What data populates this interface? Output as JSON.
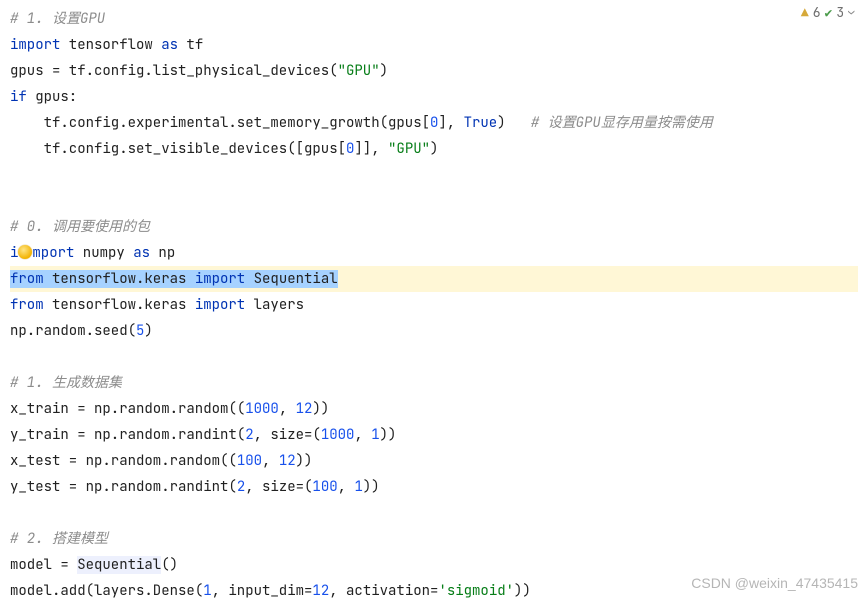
{
  "inspections": {
    "warning_count": "6",
    "ok_count": "3"
  },
  "code": {
    "c1_comment": "# 1. 设置GPU",
    "c1_l1a": "import",
    "c1_l1b": " tensorflow ",
    "c1_l1c": "as",
    "c1_l1d": " tf",
    "c1_l2a": "gpus = tf.config.list_physical_devices(",
    "c1_l2s": "\"GPU\"",
    "c1_l2b": ")",
    "c1_l3a": "if",
    "c1_l3b": " gpus:",
    "c1_l4a": "    tf.config.experimental.set_memory_growth(gpus[",
    "c1_l4n": "0",
    "c1_l4b": "], ",
    "c1_l4t": "True",
    "c1_l4c": ")   ",
    "c1_l4cm": "# 设置GPU显存用量按需使用",
    "c1_l5a": "    tf.config.set_visible_devices([gpus[",
    "c1_l5n": "0",
    "c1_l5b": "]], ",
    "c1_l5s": "\"GPU\"",
    "c1_l5c": ")",
    "c0_comment": "# 0. 调用要使用的包",
    "c0_l1a": "mport",
    "c0_l1b": " numpy ",
    "c0_l1c": "as",
    "c0_l1d": " np",
    "c0_l2a": "from",
    "c0_l2b": " tensorflow.keras ",
    "c0_l2c": "import",
    "c0_l2d": " Sequential",
    "c0_l3a": "from",
    "c0_l3b": " tensorflow.keras ",
    "c0_l3c": "import",
    "c0_l3d": " layers",
    "c0_l4": "np.random.seed(",
    "c0_l4n": "5",
    "c0_l4b": ")",
    "s1_comment": "# 1. 生成数据集",
    "s1_l1a": "x_train = np.random.random((",
    "s1_l1n1": "1000",
    "s1_l1m": ", ",
    "s1_l1n2": "12",
    "s1_l1b": "))",
    "s1_l2a": "y_train = np.random.randint(",
    "s1_l2n1": "2",
    "s1_l2m": ", size=(",
    "s1_l2n2": "1000",
    "s1_l2m2": ", ",
    "s1_l2n3": "1",
    "s1_l2b": "))",
    "s1_l3a": "x_test = np.random.random((",
    "s1_l3n1": "100",
    "s1_l3m": ", ",
    "s1_l3n2": "12",
    "s1_l3b": "))",
    "s1_l4a": "y_test = np.random.randint(",
    "s1_l4n1": "2",
    "s1_l4m": ", size=(",
    "s1_l4n2": "100",
    "s1_l4m2": ", ",
    "s1_l4n3": "1",
    "s1_l4b": "))",
    "s2_comment": "# 2. 搭建模型",
    "s2_l1a": "model = ",
    "s2_l1b": "Sequential",
    "s2_l1c": "()",
    "s2_l2a": "model.add(layers.Dense(",
    "s2_l2n1": "1",
    "s2_l2m": ", input_dim=",
    "s2_l2n2": "12",
    "s2_l2m2": ", activation=",
    "s2_l2s": "'sigmoid'",
    "s2_l2b": "))"
  },
  "watermark": "CSDN @weixin_47435415"
}
